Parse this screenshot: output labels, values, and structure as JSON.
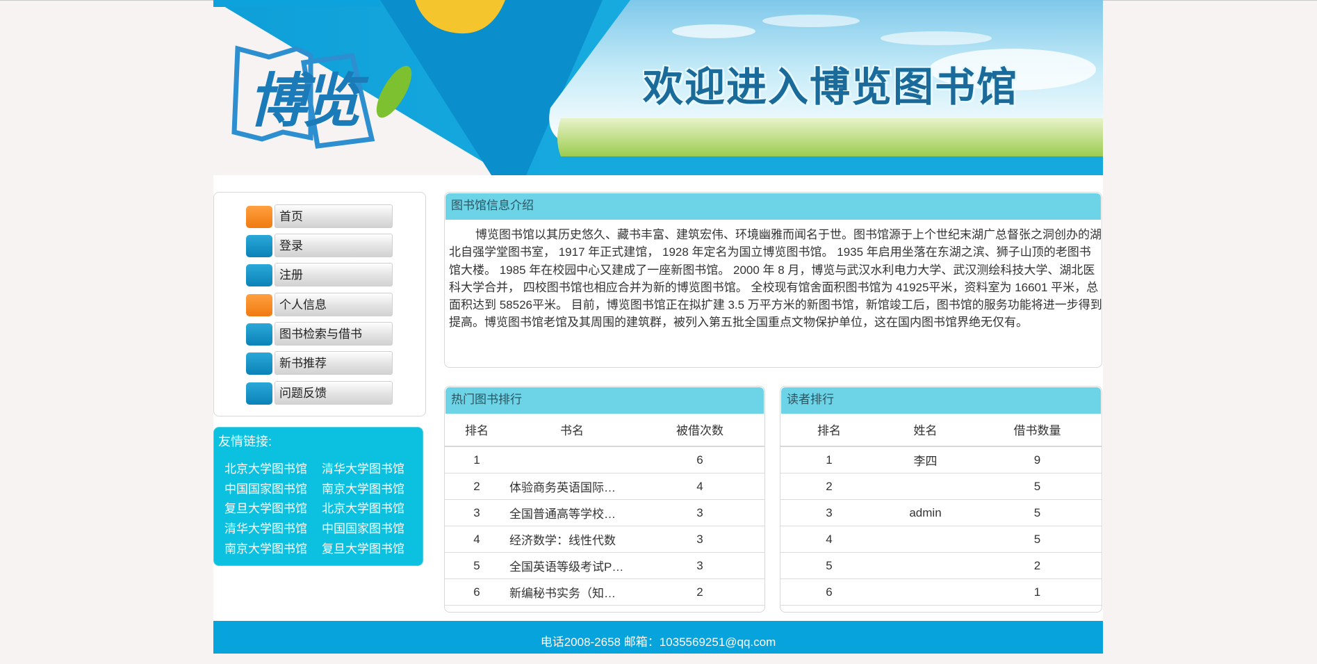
{
  "banner": {
    "logo_text": "博览",
    "welcome_text": "欢迎进入博览图书馆"
  },
  "nav": {
    "items": [
      {
        "label": "首页",
        "color": "orange"
      },
      {
        "label": "登录",
        "color": "blue"
      },
      {
        "label": "注册",
        "color": "blue"
      },
      {
        "label": "个人信息",
        "color": "orange"
      },
      {
        "label": "图书检索与借书",
        "color": "blue"
      },
      {
        "label": "新书推荐",
        "color": "blue"
      },
      {
        "label": "问题反馈",
        "color": "blue"
      }
    ]
  },
  "links": {
    "title": "友情链接:",
    "items": [
      "北京大学图书馆",
      "清华大学图书馆",
      "中国国家图书馆",
      "南京大学图书馆",
      "复旦大学图书馆",
      "北京大学图书馆",
      "清华大学图书馆",
      "中国国家图书馆",
      "南京大学图书馆",
      "复旦大学图书馆"
    ]
  },
  "intro": {
    "title": "图书馆信息介绍",
    "text": "博览图书馆以其历史悠久、藏书丰富、建筑宏伟、环境幽雅而闻名于世。图书馆源于上个世纪末湖广总督张之洞创办的湖北自强学堂图书室， 1917 年正式建馆， 1928 年定名为国立博览图书馆。 1935 年启用坐落在东湖之滨、狮子山顶的老图书馆大楼。 1985 年在校园中心又建成了一座新图书馆。 2000 年 8 月，博览与武汉水利电力大学、武汉测绘科技大学、湖北医科大学合并， 四校图书馆也相应合并为新的博览图书馆。 全校现有馆舍面积图书馆为 41925平米，资料室为 16601 平米，总面积达到 58526平米。 目前，博览图书馆正在拟扩建 3.5 万平方米的新图书馆，新馆竣工后，图书馆的服务功能将进一步得到提高。博览图书馆老馆及其周围的建筑群，被列入第五批全国重点文物保护单位，这在国内图书馆界绝无仅有。"
  },
  "hot_books": {
    "title": "热门图书排行",
    "headers": [
      "排名",
      "书名",
      "被借次数"
    ],
    "rows": [
      [
        "1",
        "",
        "6"
      ],
      [
        "2",
        "体验商务英语国际…",
        "4"
      ],
      [
        "3",
        "全国普通高等学校…",
        "3"
      ],
      [
        "4",
        "经济数学：线性代数",
        "3"
      ],
      [
        "5",
        "全国英语等级考试P…",
        "3"
      ],
      [
        "6",
        "新编秘书实务（知…",
        "2"
      ]
    ]
  },
  "readers": {
    "title": "读者排行",
    "headers": [
      "排名",
      "姓名",
      "借书数量"
    ],
    "rows": [
      [
        "1",
        "李四",
        "9"
      ],
      [
        "2",
        "",
        "5"
      ],
      [
        "3",
        "admin",
        "5"
      ],
      [
        "4",
        "",
        "5"
      ],
      [
        "5",
        "",
        "2"
      ],
      [
        "6",
        "",
        "1"
      ]
    ]
  },
  "footer": {
    "text": "电话2008-2658 邮箱：1035569251@qq.com"
  }
}
